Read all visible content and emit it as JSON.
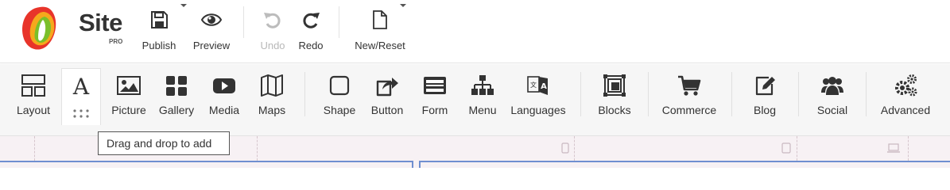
{
  "brand": {
    "name": "Site",
    "badge": "PRO"
  },
  "top_toolbar": {
    "publish": "Publish",
    "preview": "Preview",
    "undo": "Undo",
    "redo": "Redo",
    "new_reset": "New/Reset"
  },
  "widgets": {
    "layout": "Layout",
    "text": "",
    "picture": "Picture",
    "gallery": "Gallery",
    "media": "Media",
    "maps": "Maps",
    "shape": "Shape",
    "button": "Button",
    "form": "Form",
    "menu": "Menu",
    "languages": "Languages",
    "blocks": "Blocks",
    "commerce": "Commerce",
    "blog": "Blog",
    "social": "Social",
    "advanced": "Advanced"
  },
  "tooltip": "Drag and drop to add",
  "colors": {
    "accent_line": "#6f8fd0",
    "canvas_bg": "#f7f1f4",
    "toolbar_bg": "#f6f6f6"
  },
  "icons": [
    "save-icon",
    "eye-icon",
    "undo-icon",
    "redo-icon",
    "new-file-icon",
    "layout-icon",
    "text-a-icon",
    "picture-icon",
    "gallery-icon",
    "media-play-icon",
    "map-icon",
    "square-icon",
    "share-arrow-icon",
    "form-icon",
    "sitemap-icon",
    "translate-icon",
    "blocks-icon",
    "cart-icon",
    "edit-icon",
    "users-icon",
    "gears-icon",
    "mobile-icon",
    "tablet-icon",
    "desktop-icon"
  ]
}
